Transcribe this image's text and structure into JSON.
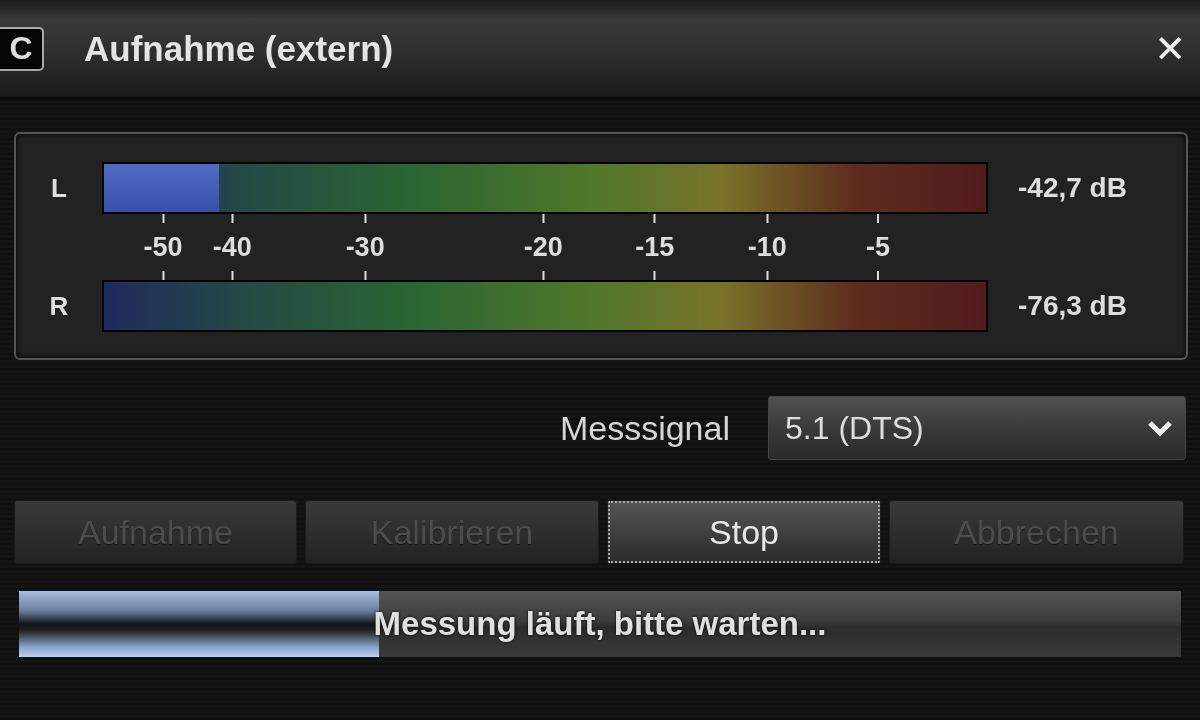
{
  "window": {
    "title": "Aufnahme (extern)",
    "app_icon": "C",
    "close": "✕"
  },
  "meters": [
    {
      "channel": "L",
      "level": 0.13,
      "reading": "-42,7 dB"
    },
    {
      "channel": "R",
      "level": 0,
      "reading": "-76,3 dB"
    }
  ],
  "scale": [
    "-50",
    "-40",
    "-30",
    "-20",
    "-15",
    "-10",
    "-5"
  ],
  "signal": {
    "label": "Messsignal",
    "value": "5.1 (DTS)"
  },
  "buttons": [
    {
      "label": "Aufnahme",
      "disabled": true,
      "focused": false
    },
    {
      "label": "Kalibrieren",
      "disabled": true,
      "focused": false
    },
    {
      "label": "Stop",
      "disabled": false,
      "focused": true
    },
    {
      "label": "Abbrechen",
      "disabled": true,
      "focused": false
    }
  ],
  "progress": {
    "level": 0.31,
    "text": "Messung läuft, bitte warten..."
  }
}
